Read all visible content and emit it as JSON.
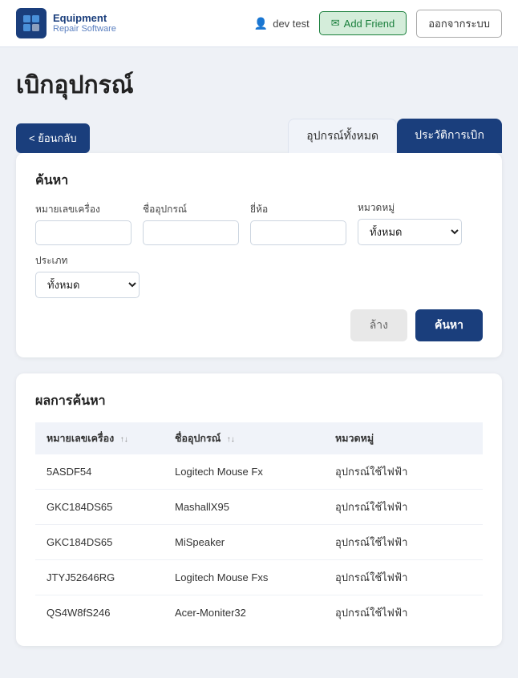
{
  "header": {
    "logo_line1": "Equipment",
    "logo_line2": "Repair Software",
    "user_label": "dev test",
    "add_friend_label": "Add Friend",
    "logout_label": "ออกจากระบบ"
  },
  "page": {
    "title": "เบิกอุปกรณ์",
    "back_label": "< ย้อนกลับ",
    "tabs": [
      {
        "label": "อุปกรณ์ทั้งหมด",
        "active": false
      },
      {
        "label": "ประวัติการเบิก",
        "active": true
      }
    ]
  },
  "search_form": {
    "title": "ค้นหา",
    "fields": {
      "serial_label": "หมายเลขเครื่อง",
      "serial_placeholder": "",
      "name_label": "ชื่ออุปกรณ์",
      "name_placeholder": "",
      "brand_label": "ยี่ห้อ",
      "brand_placeholder": "",
      "group_label": "หมวดหมู่",
      "group_default": "ทั้งหมด",
      "type_label": "ประเภท",
      "type_default": "ทั้งหมด"
    },
    "clear_label": "ล้าง",
    "search_label": "ค้นหา"
  },
  "results": {
    "title": "ผลการค้นหา",
    "columns": [
      {
        "label": "หมายเลขเครื่อง",
        "sortable": true
      },
      {
        "label": "ชื่ออุปกรณ์",
        "sortable": true
      },
      {
        "label": "หมวดหมู่",
        "sortable": false
      }
    ],
    "rows": [
      {
        "serial": "5ASDF54",
        "name": "Logitech Mouse Fx",
        "group": "อุปกรณ์ใช้ไฟฟ้า"
      },
      {
        "serial": "GKC184DS65",
        "name": "MashallX95",
        "group": "อุปกรณ์ใช้ไฟฟ้า"
      },
      {
        "serial": "GKC184DS65",
        "name": "MiSpeaker",
        "group": "อุปกรณ์ใช้ไฟฟ้า"
      },
      {
        "serial": "JTYJ52646RG",
        "name": "Logitech Mouse Fxs",
        "group": "อุปกรณ์ใช้ไฟฟ้า"
      },
      {
        "serial": "QS4W8fS246",
        "name": "Acer-Moniter32",
        "group": "อุปกรณ์ใช้ไฟฟ้า"
      }
    ]
  }
}
